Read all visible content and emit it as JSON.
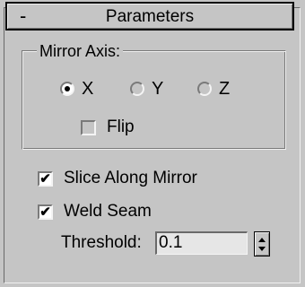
{
  "rollout": {
    "collapse_symbol": "-",
    "title": "Parameters"
  },
  "mirror_axis": {
    "label": "Mirror Axis:",
    "options": [
      {
        "label": "X",
        "selected": true
      },
      {
        "label": "Y",
        "selected": false
      },
      {
        "label": "Z",
        "selected": false
      }
    ],
    "flip": {
      "label": "Flip",
      "checked": false
    }
  },
  "slice_along_mirror": {
    "label": "Slice Along Mirror",
    "checked": true
  },
  "weld_seam": {
    "label": "Weld Seam",
    "checked": true
  },
  "threshold": {
    "label": "Threshold:",
    "value": "0.1"
  },
  "check_glyph": "✔"
}
